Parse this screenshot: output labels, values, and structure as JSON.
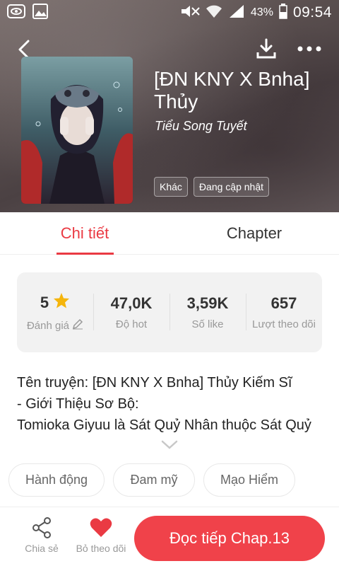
{
  "status_bar": {
    "battery": "43%",
    "time": "09:54"
  },
  "book": {
    "title": "[ĐN KNY X Bnha] Thủy",
    "author": "Tiểu Song Tuyết",
    "tags": [
      "Khác",
      "Đang cập nhật"
    ]
  },
  "tabs": [
    {
      "label": "Chi tiết",
      "active": true
    },
    {
      "label": "Chapter",
      "active": false
    }
  ],
  "stats": [
    {
      "value": "5",
      "label": "Đánh giá"
    },
    {
      "value": "47,0K",
      "label": "Độ hot"
    },
    {
      "value": "3,59K",
      "label": "Số like"
    },
    {
      "value": "657",
      "label": "Lượt theo dõi"
    }
  ],
  "description": {
    "lines": [
      "Tên truyện: [ĐN KNY X Bnha] Thủy Kiếm Sĩ",
      "- Giới Thiệu Sơ Bộ:",
      "Tomioka Giyuu là Sát Quỷ Nhân thuộc Sát Quỷ"
    ]
  },
  "genres": [
    "Hành động",
    "Đam mỹ",
    "Mạo Hiểm"
  ],
  "bottom": {
    "share_label": "Chia sẻ",
    "follow_label": "Bỏ theo dõi",
    "read_label": "Đọc tiếp Chap.13"
  },
  "colors": {
    "accent": "#ea3a43",
    "button": "#f0424a",
    "star": "#f5b50c"
  }
}
